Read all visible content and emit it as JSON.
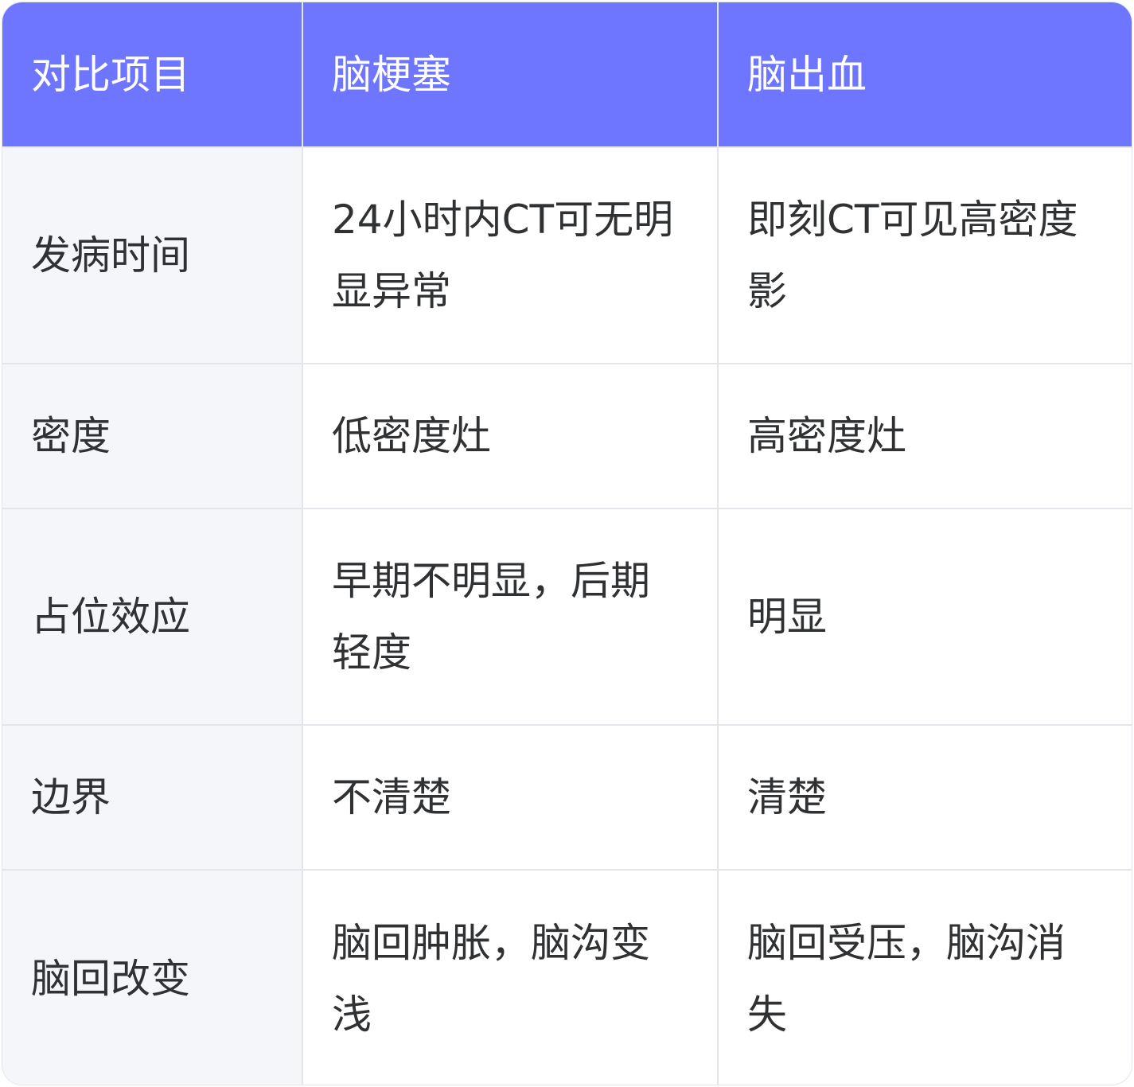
{
  "table": {
    "headers": [
      "对比项目",
      "脑梗塞",
      "脑出血"
    ],
    "rows": [
      [
        "发病时间",
        "24小时内CT可无明显异常",
        "即刻CT可见高密度影"
      ],
      [
        "密度",
        "低密度灶",
        "高密度灶"
      ],
      [
        "占位效应",
        "早期不明显，后期轻度",
        "明显"
      ],
      [
        "边界",
        "不清楚",
        "清楚"
      ],
      [
        "脑回改变",
        "脑回肿胀，脑沟变浅",
        "脑回受压，脑沟消失"
      ]
    ]
  },
  "colors": {
    "header_bg": "#6e76ff",
    "header_text": "#ffffff",
    "row_header_bg": "#f5f6fa",
    "cell_bg": "#ffffff",
    "border": "#e3e5ea",
    "text": "#2f3133"
  }
}
